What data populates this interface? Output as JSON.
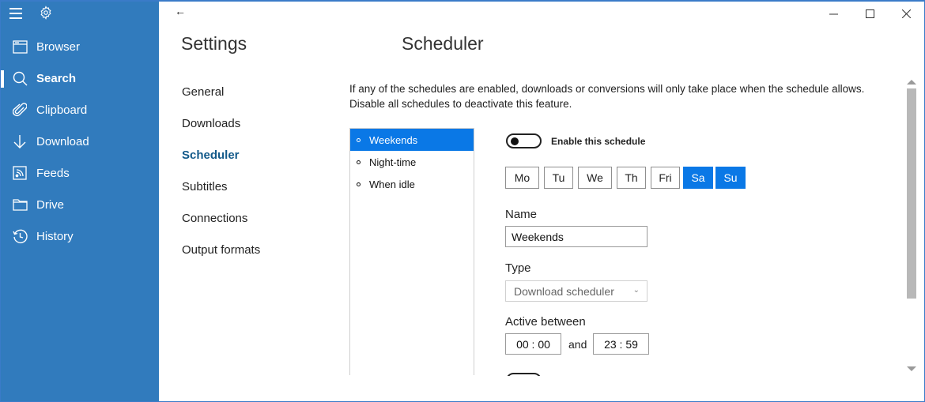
{
  "sidebar": {
    "items": [
      {
        "label": "Browser",
        "icon": "browser-window-icon",
        "active": false
      },
      {
        "label": "Search",
        "icon": "search-icon",
        "active": true
      },
      {
        "label": "Clipboard",
        "icon": "paperclip-icon",
        "active": false
      },
      {
        "label": "Download",
        "icon": "download-arrow-icon",
        "active": false
      },
      {
        "label": "Feeds",
        "icon": "rss-feed-icon",
        "active": false
      },
      {
        "label": "Drive",
        "icon": "folder-icon",
        "active": false
      },
      {
        "label": "History",
        "icon": "history-icon",
        "active": false
      }
    ]
  },
  "titlebar": {
    "back_glyph": "←",
    "minimize_glyph": "—",
    "maximize_glyph": "☐",
    "close_glyph": "✕"
  },
  "header": {
    "settings_title": "Settings",
    "page_title": "Scheduler"
  },
  "categories": [
    {
      "label": "General",
      "active": false
    },
    {
      "label": "Downloads",
      "active": false
    },
    {
      "label": "Scheduler",
      "active": true
    },
    {
      "label": "Subtitles",
      "active": false
    },
    {
      "label": "Connections",
      "active": false
    },
    {
      "label": "Output formats",
      "active": false
    }
  ],
  "scheduler": {
    "description_line1": "If any of the schedules are enabled, downloads or conversions will only take place when the schedule allows.",
    "description_line2": "Disable all schedules to deactivate this feature.",
    "schedules": [
      {
        "label": "Weekends",
        "selected": true
      },
      {
        "label": "Night-time",
        "selected": false
      },
      {
        "label": "When idle",
        "selected": false
      }
    ],
    "enable_label": "Enable this schedule",
    "enabled": false,
    "days": [
      {
        "label": "Mo",
        "selected": false
      },
      {
        "label": "Tu",
        "selected": false
      },
      {
        "label": "We",
        "selected": false
      },
      {
        "label": "Th",
        "selected": false
      },
      {
        "label": "Fri",
        "selected": false
      },
      {
        "label": "Sa",
        "selected": true
      },
      {
        "label": "Su",
        "selected": true
      }
    ],
    "name_label": "Name",
    "name_value": "Weekends",
    "type_label": "Type",
    "type_value": "Download scheduler",
    "active_label": "Active between",
    "start_time": "00 : 00",
    "and_label": "and",
    "end_time": "23 : 59"
  },
  "colors": {
    "sidebar_bg": "#317bbd",
    "accent": "#0a78e6",
    "active_category": "#135a8a"
  }
}
